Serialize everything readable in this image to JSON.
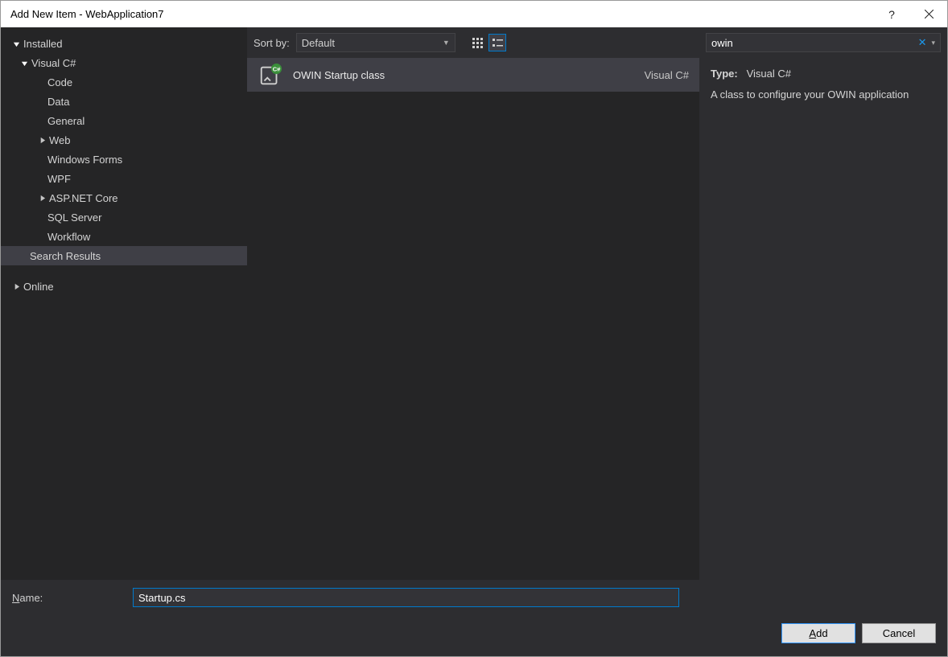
{
  "titlebar": {
    "title": "Add New Item - WebApplication7"
  },
  "tree": {
    "installed": "Installed",
    "visual_csharp": "Visual C#",
    "code": "Code",
    "data": "Data",
    "general": "General",
    "web": "Web",
    "windows_forms": "Windows Forms",
    "wpf": "WPF",
    "aspnet_core": "ASP.NET Core",
    "sql_server": "SQL Server",
    "workflow": "Workflow",
    "search_results": "Search Results",
    "online": "Online"
  },
  "sortbar": {
    "label": "Sort by:",
    "value": "Default"
  },
  "template": {
    "name": "OWIN Startup class",
    "lang": "Visual C#"
  },
  "search": {
    "value": "owin"
  },
  "details": {
    "type_label": "Type:",
    "type_value": "Visual C#",
    "desc": "A class to configure your OWIN application"
  },
  "footer": {
    "name_label_pre": "N",
    "name_label_post": "ame:",
    "name_value": "Startup.cs",
    "add_pre": "A",
    "add_post": "dd",
    "cancel": "Cancel"
  }
}
